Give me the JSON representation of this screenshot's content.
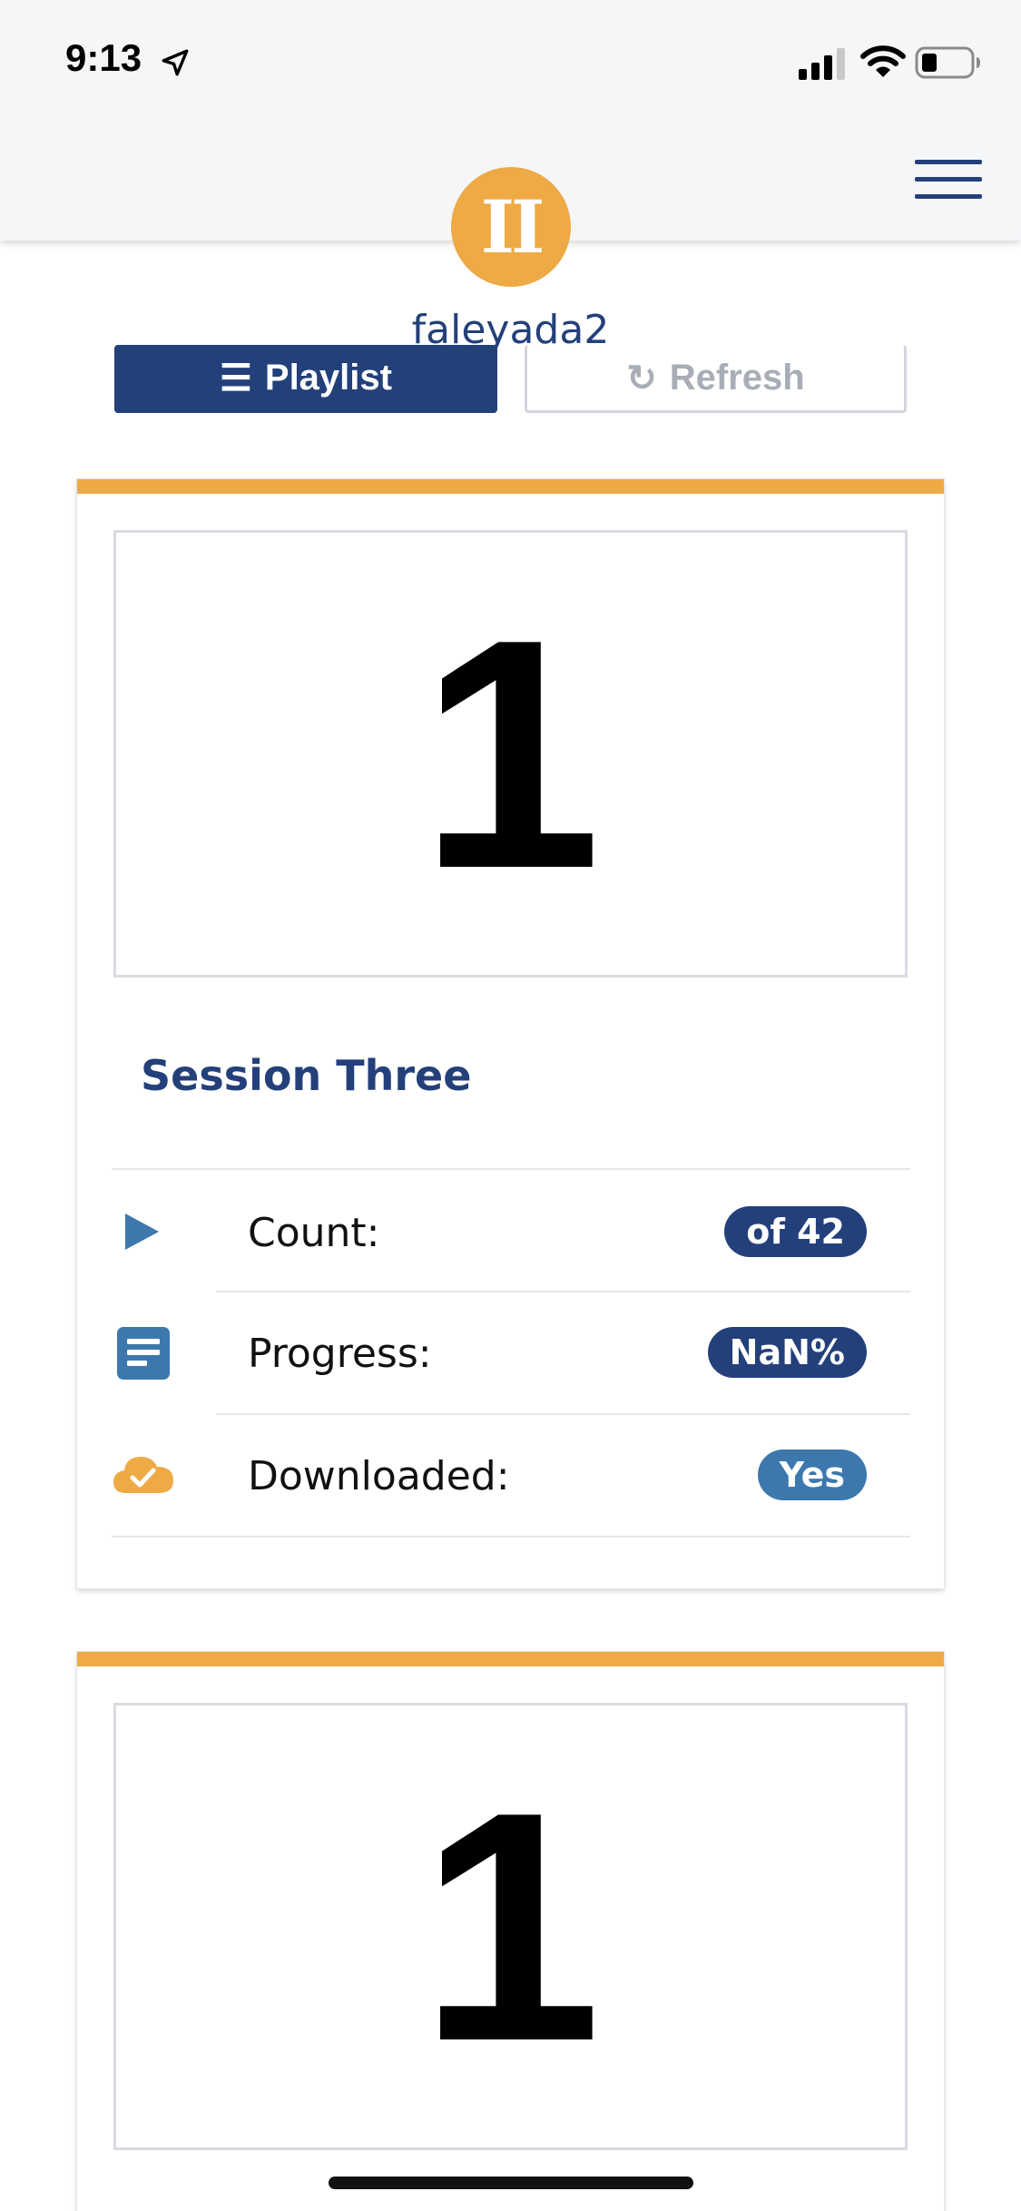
{
  "status_bar": {
    "time": "9:13",
    "icons": [
      "location-arrow-icon",
      "cell-signal-icon",
      "wifi-icon",
      "battery-icon"
    ]
  },
  "header": {
    "logo_text": "II",
    "username": "faleyada2",
    "menu_icon": "hamburger-menu-icon"
  },
  "actions": {
    "playlist_label": "Playlist",
    "refresh_label": "Refresh"
  },
  "colors": {
    "accent_orange": "#eeaa45",
    "navy": "#23407a",
    "steel_blue": "#3c78ad",
    "header_bg": "#f5f6f8"
  },
  "sessions": [
    {
      "thumbnail_number": "1",
      "title": "Session Three",
      "rows": [
        {
          "icon": "play-icon",
          "label": "Count:",
          "value": "of 42"
        },
        {
          "icon": "document-icon",
          "label": "Progress:",
          "value": "NaN%"
        },
        {
          "icon": "cloud-check-icon",
          "label": "Downloaded:",
          "value": "Yes"
        }
      ]
    },
    {
      "thumbnail_number": "1"
    }
  ]
}
